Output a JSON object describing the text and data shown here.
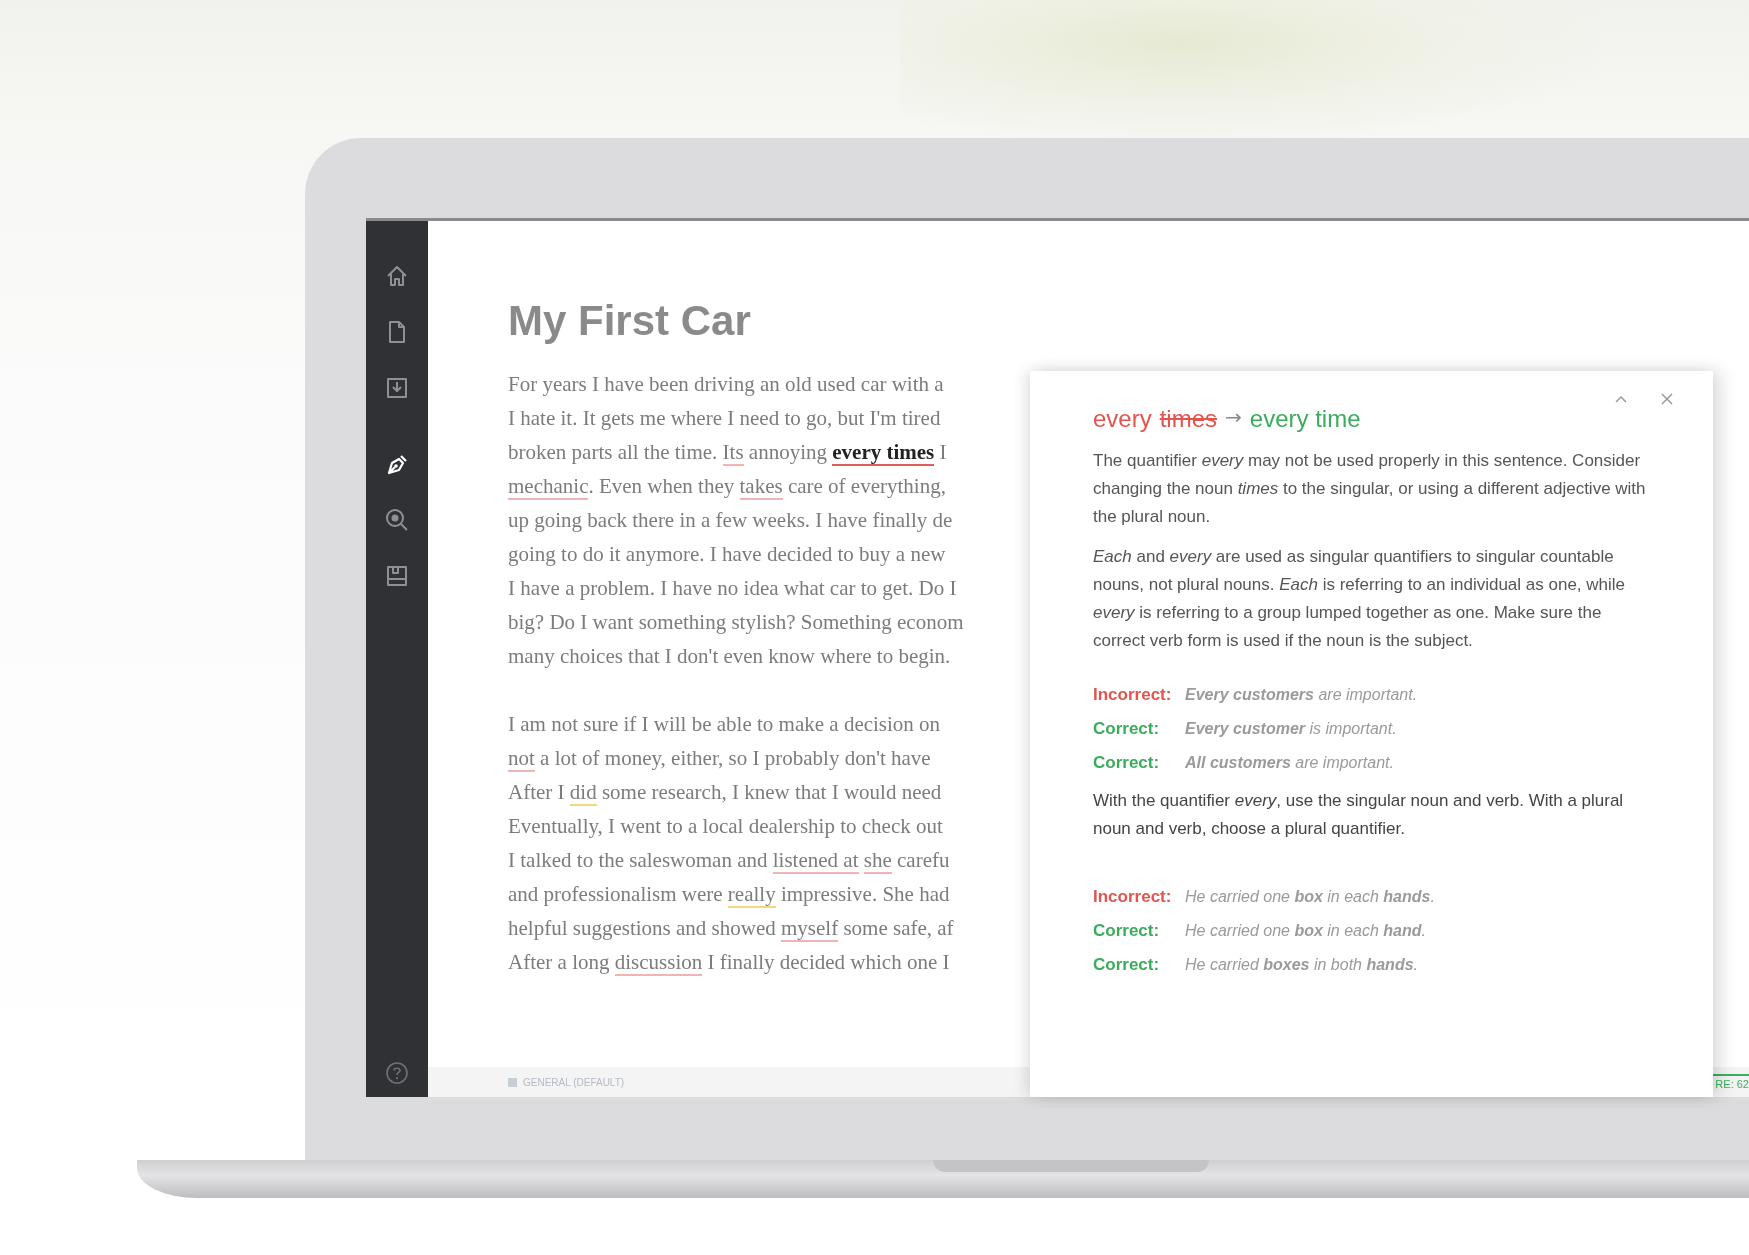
{
  "sidebar": {
    "items": [
      {
        "kind": "home",
        "selected": false
      },
      {
        "kind": "document",
        "selected": false
      },
      {
        "kind": "download",
        "selected": false
      },
      {
        "kind": "pen",
        "selected": true
      },
      {
        "kind": "search",
        "selected": false
      },
      {
        "kind": "save",
        "selected": false
      }
    ]
  },
  "document": {
    "title": "My First Car",
    "paragraphs": [
      {
        "lines": [
          [
            {
              "text": "For years I have been driving an old used car with a",
              "kind": "plain"
            }
          ],
          [
            {
              "text": "I hate it. It gets me where I need to go, but I'm tired",
              "kind": "plain"
            }
          ],
          [
            {
              "text": "broken parts all the time. ",
              "kind": "plain"
            },
            {
              "text": "Its",
              "kind": "error"
            },
            {
              "text": " annoying ",
              "kind": "plain"
            },
            {
              "text": "every times",
              "kind": "focus"
            },
            {
              "text": " I",
              "kind": "plain"
            }
          ],
          [
            {
              "text": "mechanic",
              "kind": "error"
            },
            {
              "text": ". Even when they ",
              "kind": "plain"
            },
            {
              "text": "takes",
              "kind": "error"
            },
            {
              "text": " care of everything,",
              "kind": "plain"
            }
          ],
          [
            {
              "text": "up going back there in a few weeks. I have finally de",
              "kind": "plain"
            }
          ],
          [
            {
              "text": "going to do it anymore. I have decided to buy a new",
              "kind": "plain"
            }
          ],
          [
            {
              "text": "I have a problem. I have no idea what car to get. Do I",
              "kind": "plain"
            }
          ],
          [
            {
              "text": "big? Do I want something stylish? Something econom",
              "kind": "plain"
            }
          ],
          [
            {
              "text": "many choices that I don't even know where to begin.",
              "kind": "plain"
            }
          ]
        ]
      },
      {
        "lines": [
          [
            {
              "text": "I am not sure if I will be able to make a decision on",
              "kind": "plain"
            }
          ],
          [
            {
              "text": "not",
              "kind": "error"
            },
            {
              "text": " a lot of money, either, so I probably don't have",
              "kind": "plain"
            }
          ],
          [
            {
              "text": "After I ",
              "kind": "plain"
            },
            {
              "text": "did",
              "kind": "warning"
            },
            {
              "text": " some research, I knew that I would need",
              "kind": "plain"
            }
          ],
          [
            {
              "text": "Eventually, I went to a local dealership to check out",
              "kind": "plain"
            }
          ],
          [
            {
              "text": "I talked to the saleswoman and ",
              "kind": "plain"
            },
            {
              "text": "listened at ",
              "kind": "error"
            },
            {
              "text": "she",
              "kind": "error"
            },
            {
              "text": " carefu",
              "kind": "plain"
            }
          ],
          [
            {
              "text": "and professionalism were ",
              "kind": "plain"
            },
            {
              "text": "really",
              "kind": "warning"
            },
            {
              "text": " impressive. She had",
              "kind": "plain"
            }
          ],
          [
            {
              "text": "helpful suggestions and showed ",
              "kind": "plain"
            },
            {
              "text": "myself",
              "kind": "error"
            },
            {
              "text": " some safe, af",
              "kind": "plain"
            }
          ],
          [
            {
              "text": "After a long ",
              "kind": "plain"
            },
            {
              "text": "discussion",
              "kind": "error"
            },
            {
              "text": " I finally decided which one I",
              "kind": "plain"
            }
          ]
        ]
      }
    ]
  },
  "status_bar": {
    "mode": "GENERAL (DEFAULT)",
    "score": "RE: 62"
  },
  "suggestion_card": {
    "title": [
      {
        "text": "every",
        "kind": "wrong"
      },
      {
        "text": "times",
        "kind": "struck"
      },
      {
        "text": "→",
        "kind": "arrow"
      },
      {
        "text": "every time",
        "kind": "fix"
      }
    ],
    "explanation": [
      "The quantifier *every* may not be used properly in this sentence. Consider changing the noun *times* to the singular, or using a different adjective with the plural noun.",
      "*Each* and *every* are used as singular quantifiers to singular countable nouns, not plural nouns. *Each* is referring to an individual as one, while *every* is referring to a group lumped together as one. Make sure the correct verb form is used if the noun is the subject."
    ],
    "examples_1": [
      {
        "kind": "incorrect",
        "label": "Incorrect:",
        "sentence": "**Every customers** are important."
      },
      {
        "kind": "correct",
        "label": "Correct:",
        "sentence": "**Every customer** is important."
      },
      {
        "kind": "correct",
        "label": "Correct:",
        "sentence": "**All customers** are important."
      }
    ],
    "note": "With the quantifier *every*, use the singular noun and verb. With a plural noun and verb, choose a plural quantifier.",
    "examples_2": [
      {
        "kind": "incorrect",
        "label": "Incorrect:",
        "sentence": "He carried one **box** in each **hands**."
      },
      {
        "kind": "correct",
        "label": "Correct:",
        "sentence": "He carried one **box** in each **hand**."
      },
      {
        "kind": "correct",
        "label": "Correct:",
        "sentence": "He carried **boxes** in both **hands**."
      }
    ]
  }
}
